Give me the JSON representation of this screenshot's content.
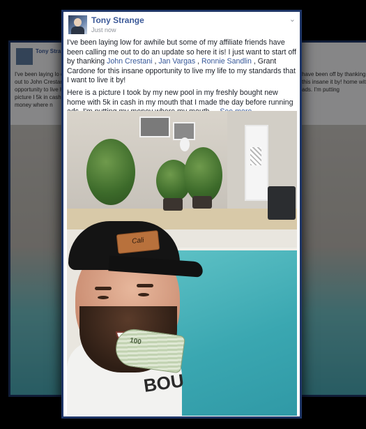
{
  "ghost_left": {
    "name": "Tony Stra",
    "time": "Just now",
    "text": "I've been laying lo calling me out to John Crestani , Ja opportunity to live Here is a picture I 5k in cash in my m my money where n"
  },
  "ghost_right": {
    "name": "",
    "time": "",
    "text": "have been off by thanking for this insane it by! home with ads. I'm putting"
  },
  "post": {
    "author": "Tony Strange",
    "time": "Just now",
    "para1_start": "I've been laying low for awhile but some of my affiliate friends have been calling me out to do an update so here it is! I just want to start off by thanking ",
    "mention1": "John Crestani",
    "sep1": " , ",
    "mention2": "Jan Vargas",
    "sep2": " , ",
    "mention3": "Ronnie Sandlin",
    "para1_end": " , Grant Cardone for this insane opportunity to live my life to my standards that I want to live it by!",
    "para2": "Here is a picture I took by my new pool in my freshly bought new home with 5k in cash in my mouth that I made the day before running ads. I'm putting my money where my mouth ",
    "ellipsis": "...",
    "see_more": "See more"
  },
  "photo": {
    "cap_patch": "Cali",
    "shirt_text": "BOU",
    "bill_text": "100"
  },
  "icons": {
    "chevron": "chevron-down-icon"
  },
  "colors": {
    "link": "#365899",
    "author": "#3b5998",
    "frame_border": "#1e3566",
    "background": "#000000"
  }
}
